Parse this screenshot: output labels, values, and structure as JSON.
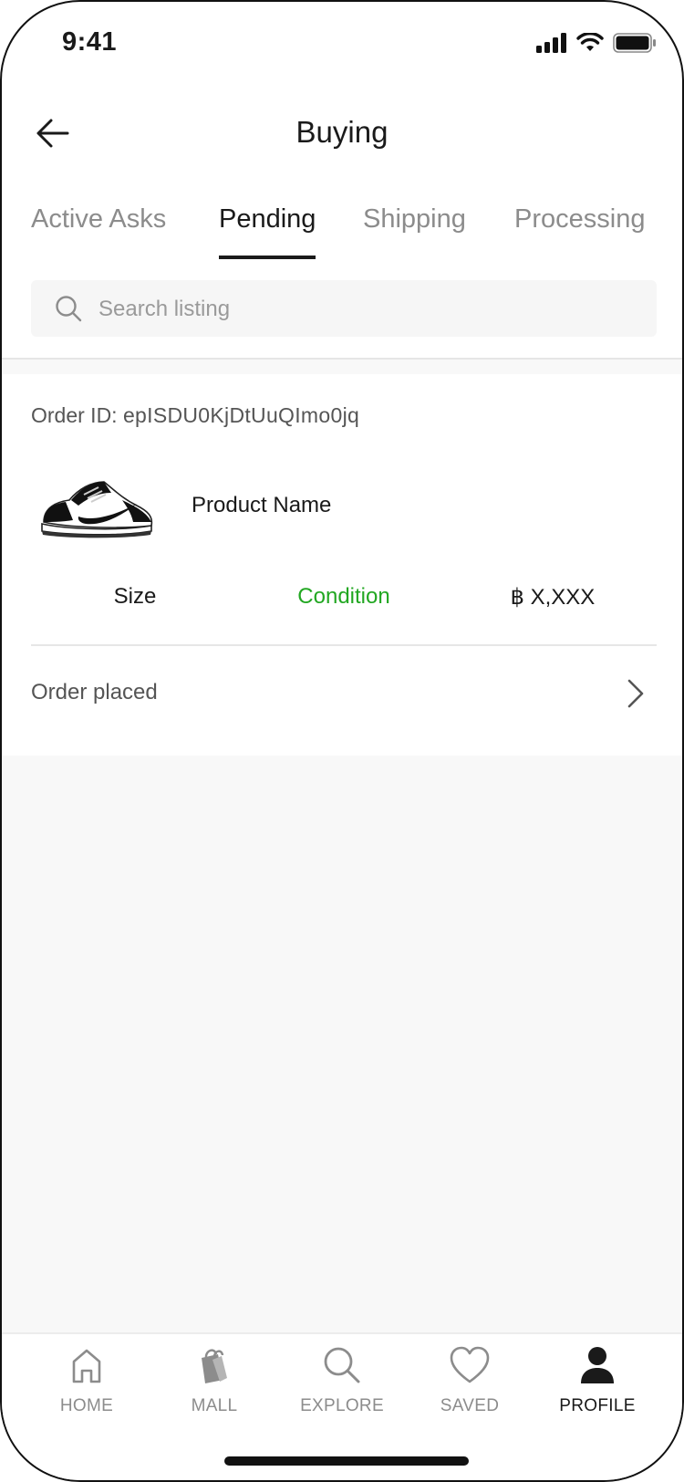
{
  "status_bar": {
    "time": "9:41"
  },
  "header": {
    "title": "Buying",
    "back_icon": "arrow-left-icon"
  },
  "tabs": [
    {
      "label": "Active Asks",
      "active": false
    },
    {
      "label": "Pending",
      "active": true
    },
    {
      "label": "Shipping",
      "active": false
    },
    {
      "label": "Processing",
      "active": false
    }
  ],
  "search": {
    "placeholder": "Search listing",
    "value": "",
    "icon": "search-icon"
  },
  "order": {
    "id_label": "Order ID:",
    "id_value": "epISDU0KjDtUuQImo0jq",
    "product_name": "Product Name",
    "size_label": "Size",
    "condition_label": "Condition",
    "price": "฿ X,XXX",
    "status_label": "Order placed"
  },
  "bottom_nav": {
    "items": [
      {
        "label": "HOME",
        "icon": "home-icon",
        "active": false
      },
      {
        "label": "MALL",
        "icon": "shopping-bag-icon",
        "active": false
      },
      {
        "label": "EXPLORE",
        "icon": "search-icon",
        "active": false
      },
      {
        "label": "SAVED",
        "icon": "heart-icon",
        "active": false
      },
      {
        "label": "PROFILE",
        "icon": "user-icon",
        "active": true
      }
    ]
  },
  "colors": {
    "accent_green": "#22a722",
    "text_primary": "#1a1a1a",
    "text_muted": "#8c8c8c",
    "background_secondary": "#f8f8f8"
  }
}
